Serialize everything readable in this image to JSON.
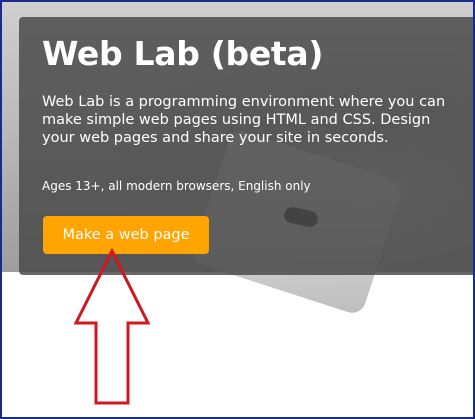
{
  "hero": {
    "title": "Web Lab (beta)",
    "description": "Web Lab is a programming environment where you can make simple web pages using HTML and CSS. Design your web pages and share your site in seconds.",
    "meta": "Ages 13+, all modern browsers, English only",
    "cta_label": "Make a web page"
  },
  "colors": {
    "cta_background": "#ffa400",
    "frame_border": "#1a2b8c",
    "annotation_arrow": "#d0161e"
  },
  "icons": {
    "annotation": "arrow-up-icon"
  }
}
